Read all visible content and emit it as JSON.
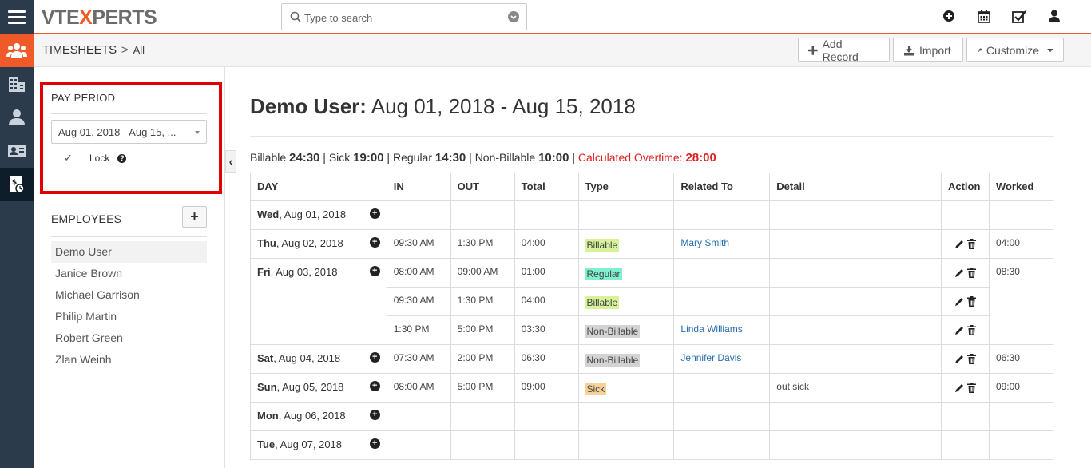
{
  "app": {
    "logo_left": "VTE",
    "logo_x": "X",
    "logo_right": "PERTS",
    "accent": "#f05a28"
  },
  "search": {
    "placeholder": "Type to search"
  },
  "topbar_icons": [
    "plus-circle-icon",
    "calendar-icon",
    "checkbox-icon",
    "user-icon"
  ],
  "rail_icons": [
    "menu-icon",
    "users-group-icon",
    "building-icon",
    "person-icon",
    "contact-card-icon",
    "timesheet-icon"
  ],
  "breadcrumb": {
    "module": "TIMESHEETS",
    "separator": ">",
    "filter": "All"
  },
  "toolbar": {
    "add_record": "Add Record",
    "import": "Import",
    "customize": "Customize"
  },
  "pay_period": {
    "title": "PAY PERIOD",
    "selected": "Aug 01, 2018 - Aug 15, ...",
    "lock_label": "Lock",
    "lock_checked": true
  },
  "employees": {
    "title": "EMPLOYEES",
    "items": [
      "Demo User",
      "Janice Brown",
      "Michael Garrison",
      "Philip Martin",
      "Robert Green",
      "Zlan Weinh"
    ],
    "selected_index": 0
  },
  "main": {
    "user": "Demo User:",
    "range": "Aug 01, 2018 - Aug 15, 2018"
  },
  "summary": {
    "billable_label": "Billable",
    "billable": "24:30",
    "sick_label": "Sick",
    "sick": "19:00",
    "regular_label": "Regular",
    "regular": "14:30",
    "nonbillable_label": "Non-Billable",
    "nonbillable": "10:00",
    "overtime_label": "Calculated Overtime:",
    "overtime": "28:00"
  },
  "table": {
    "headers": [
      "DAY",
      "IN",
      "OUT",
      "Total",
      "Type",
      "Related To",
      "Detail",
      "Action",
      "Worked"
    ],
    "days": [
      {
        "dow": "Wed",
        "date": ", Aug 01, 2018",
        "worked": "",
        "entries": []
      },
      {
        "dow": "Thu",
        "date": ", Aug 02, 2018",
        "worked": "04:00",
        "entries": [
          {
            "in": "09:30 AM",
            "out": "1:30 PM",
            "total": "04:00",
            "type": "Billable",
            "type_class": "billable",
            "related": "Mary Smith",
            "detail": ""
          }
        ]
      },
      {
        "dow": "Fri",
        "date": ", Aug 03, 2018",
        "worked": "08:30",
        "entries": [
          {
            "in": "08:00 AM",
            "out": "09:00 AM",
            "total": "01:00",
            "type": "Regular",
            "type_class": "regular",
            "related": "",
            "detail": ""
          },
          {
            "in": "09:30 AM",
            "out": "1:30 PM",
            "total": "04:00",
            "type": "Billable",
            "type_class": "billable",
            "related": "",
            "detail": ""
          },
          {
            "in": "1:30 PM",
            "out": "5:00 PM",
            "total": "03:30",
            "type": "Non-Billable",
            "type_class": "nonbill",
            "related": "Linda Williams",
            "detail": ""
          }
        ]
      },
      {
        "dow": "Sat",
        "date": ", Aug 04, 2018",
        "worked": "06:30",
        "entries": [
          {
            "in": "07:30 AM",
            "out": "2:00 PM",
            "total": "06:30",
            "type": "Non-Billable",
            "type_class": "nonbill",
            "related": "Jennifer Davis",
            "detail": ""
          }
        ]
      },
      {
        "dow": "Sun",
        "date": ", Aug 05, 2018",
        "worked": "09:00",
        "entries": [
          {
            "in": "08:00 AM",
            "out": "5:00 PM",
            "total": "09:00",
            "type": "Sick",
            "type_class": "sick",
            "related": "",
            "detail": "out sick"
          }
        ]
      },
      {
        "dow": "Mon",
        "date": ", Aug 06, 2018",
        "worked": "",
        "entries": []
      },
      {
        "dow": "Tue",
        "date": ", Aug 07, 2018",
        "worked": "",
        "entries": []
      }
    ]
  }
}
